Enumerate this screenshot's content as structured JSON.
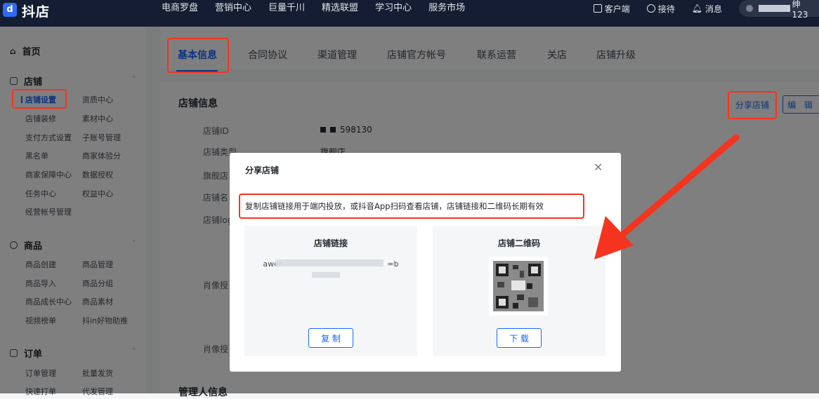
{
  "topbar": {
    "brand": "抖店",
    "logo_glyph": "d",
    "nav": [
      "电商罗盘",
      "营销中心",
      "巨量千川",
      "精选联盟",
      "学习中心",
      "服务市场"
    ],
    "right": [
      {
        "label": "客户端",
        "icon": "monitor-download-icon"
      },
      {
        "label": "接待",
        "icon": "headset-icon"
      },
      {
        "label": "消息",
        "icon": "bell-icon"
      }
    ],
    "user_suffix": "绅123"
  },
  "sidebar": {
    "home": "首页",
    "store": {
      "title": "店铺",
      "col1": [
        "店铺设置",
        "店铺装修",
        "支付方式设置",
        "黑名单",
        "商家保障中心",
        "任务中心",
        "经营帐号管理"
      ],
      "col2": [
        "资质中心",
        "素材中心",
        "子账号管理",
        "商家体验分",
        "数据授权",
        "权益中心"
      ]
    },
    "goods": {
      "title": "商品",
      "col1": [
        "商品创建",
        "商品导入",
        "商品成长中心",
        "视频榜单"
      ],
      "col2": [
        "商品管理",
        "商品分组",
        "商品素材",
        "抖in好物助推"
      ]
    },
    "order": {
      "title": "订单",
      "col1": [
        "订单管理",
        "快速打单"
      ],
      "col2": [
        "批量发货",
        "代发管理"
      ]
    }
  },
  "tabs": [
    "基本信息",
    "合同协议",
    "渠道管理",
    "店铺官方帐号",
    "联系运营",
    "关店",
    "店铺升级"
  ],
  "main": {
    "section_title": "店铺信息",
    "fields": [
      "店铺ID",
      "店铺类型",
      "旗舰店",
      "店铺名",
      "店铺log",
      "肖像授",
      "肖像授"
    ],
    "store_id_suffix": "598130",
    "store_type": "旗舰店",
    "share_button": "分享店铺",
    "edit_button": "编 辑",
    "manager_title": "管理人信息"
  },
  "modal": {
    "title": "分享店铺",
    "description": "复制店铺链接用于端内投放，或抖音App扫码查看店铺，店铺链接和二维码长期有效",
    "link_panel": {
      "title": "店铺链接",
      "text_prefix": "awer",
      "text_suffix": "=b",
      "button": "复 制"
    },
    "qr_panel": {
      "title": "店铺二维码",
      "button": "下 载"
    }
  },
  "colors": {
    "accent": "#1966ff",
    "highlight": "#f5341f",
    "topbar": "#141d32"
  }
}
